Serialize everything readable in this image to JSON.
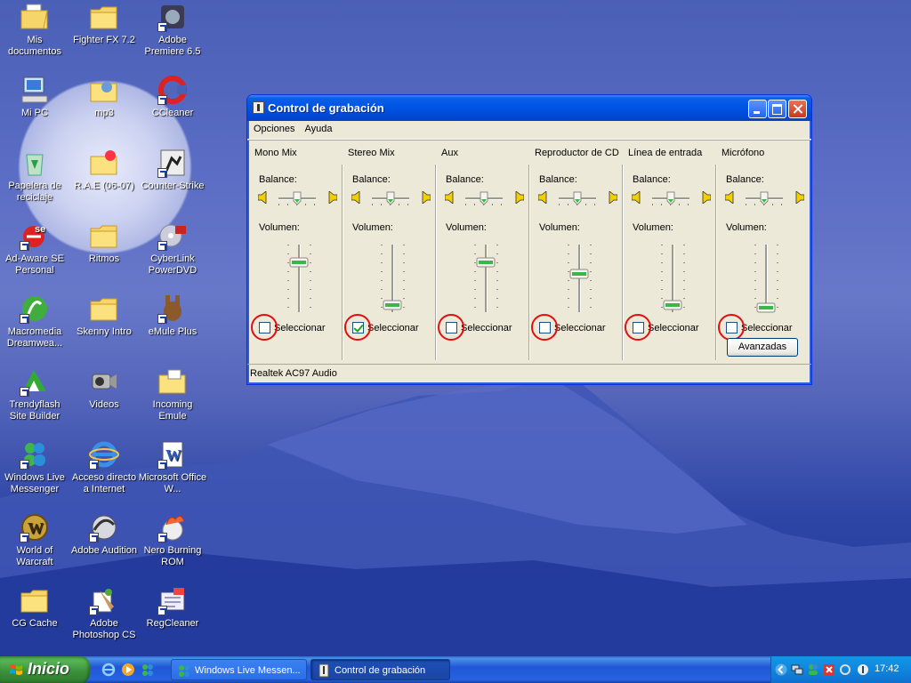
{
  "desktop": {
    "icons": [
      {
        "label": "Mis documentos",
        "icon": "folder-documents-icon"
      },
      {
        "label": "Fighter FX 7.2",
        "icon": "folder-icon"
      },
      {
        "label": "Adobe Premiere 6.5",
        "icon": "premiere-icon"
      },
      {
        "label": "Mi PC",
        "icon": "computer-icon"
      },
      {
        "label": "mp3",
        "icon": "folder-music-icon"
      },
      {
        "label": "CCleaner",
        "icon": "ccleaner-icon"
      },
      {
        "label": "Papelera de reciclaje",
        "icon": "recycle-bin-icon"
      },
      {
        "label": "R.A.E (06-07)",
        "icon": "folder-star-icon"
      },
      {
        "label": "Counter-Strike",
        "icon": "counter-strike-icon"
      },
      {
        "label": "Ad-Aware SE Personal",
        "icon": "adaware-icon"
      },
      {
        "label": "Ritmos",
        "icon": "folder-icon"
      },
      {
        "label": "CyberLink PowerDVD",
        "icon": "powerdvd-icon"
      },
      {
        "label": "Macromedia Dreamwea...",
        "icon": "dreamweaver-icon"
      },
      {
        "label": "Skenny Intro",
        "icon": "folder-icon"
      },
      {
        "label": "eMule Plus",
        "icon": "emule-icon"
      },
      {
        "label": "Trendyflash Site Builder",
        "icon": "trendyflash-icon"
      },
      {
        "label": "Videos",
        "icon": "camcorder-icon"
      },
      {
        "label": "Incoming Emule",
        "icon": "folder-incoming-icon"
      },
      {
        "label": "Windows Live Messenger",
        "icon": "messenger-icon"
      },
      {
        "label": "Acceso directo a Internet",
        "icon": "internet-explorer-icon"
      },
      {
        "label": "Microsoft Office W...",
        "icon": "word-icon"
      },
      {
        "label": "World of Warcraft",
        "icon": "warcraft-icon"
      },
      {
        "label": "Adobe Audition",
        "icon": "audition-icon"
      },
      {
        "label": "Nero Burning ROM",
        "icon": "nero-icon"
      },
      {
        "label": "CG Cache",
        "icon": "folder-icon"
      },
      {
        "label": "Adobe Photoshop CS",
        "icon": "photoshop-icon"
      },
      {
        "label": "RegCleaner",
        "icon": "regcleaner-icon"
      }
    ]
  },
  "window": {
    "title": "Control de grabación",
    "menu": [
      "Opciones",
      "Ayuda"
    ],
    "balance_label": "Balance:",
    "volume_label": "Volumen:",
    "select_label": "Seleccionar",
    "advanced_label": "Avanzadas",
    "status": "Realtek AC97 Audio",
    "channels": [
      {
        "name": "Mono Mix",
        "balance": 0.5,
        "volume": 0.8,
        "selected": false
      },
      {
        "name": "Stereo Mix",
        "balance": 0.5,
        "volume": 0.05,
        "selected": true
      },
      {
        "name": "Aux",
        "balance": 0.5,
        "volume": 0.8,
        "selected": false
      },
      {
        "name": "Reproductor de CD",
        "balance": 0.5,
        "volume": 0.6,
        "selected": false
      },
      {
        "name": "Línea de entrada",
        "balance": 0.5,
        "volume": 0.05,
        "selected": false
      },
      {
        "name": "Micrófono",
        "balance": 0.5,
        "volume": 0.0,
        "selected": false
      }
    ]
  },
  "taskbar": {
    "start_label": "Inicio",
    "tasks": [
      {
        "label": "Windows Live Messen...",
        "icon": "messenger-icon"
      },
      {
        "label": "Control de grabación",
        "icon": "volume-control-icon"
      }
    ],
    "clock": "17:42"
  }
}
